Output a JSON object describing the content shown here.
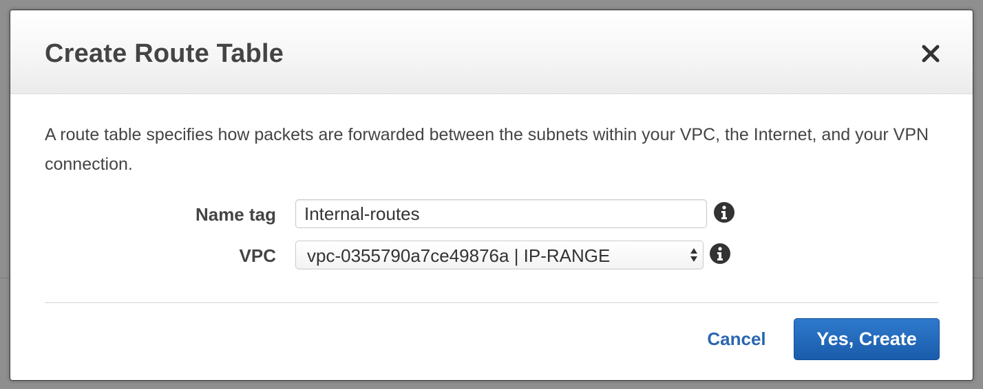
{
  "dialog": {
    "title": "Create Route Table",
    "description": "A route table specifies how packets are forwarded between the subnets within your VPC, the Internet, and your VPN connection.",
    "close_icon": "close-icon"
  },
  "form": {
    "name_tag": {
      "label": "Name tag",
      "value": "Internal-routes",
      "info_icon": "info-icon"
    },
    "vpc": {
      "label": "VPC",
      "selected": "vpc-0355790a7ce49876a | IP-RANGE",
      "info_icon": "info-icon"
    }
  },
  "footer": {
    "cancel_label": "Cancel",
    "create_label": "Yes, Create"
  },
  "colors": {
    "primary": "#1f63b5",
    "link": "#2a66b0",
    "text": "#444444"
  }
}
